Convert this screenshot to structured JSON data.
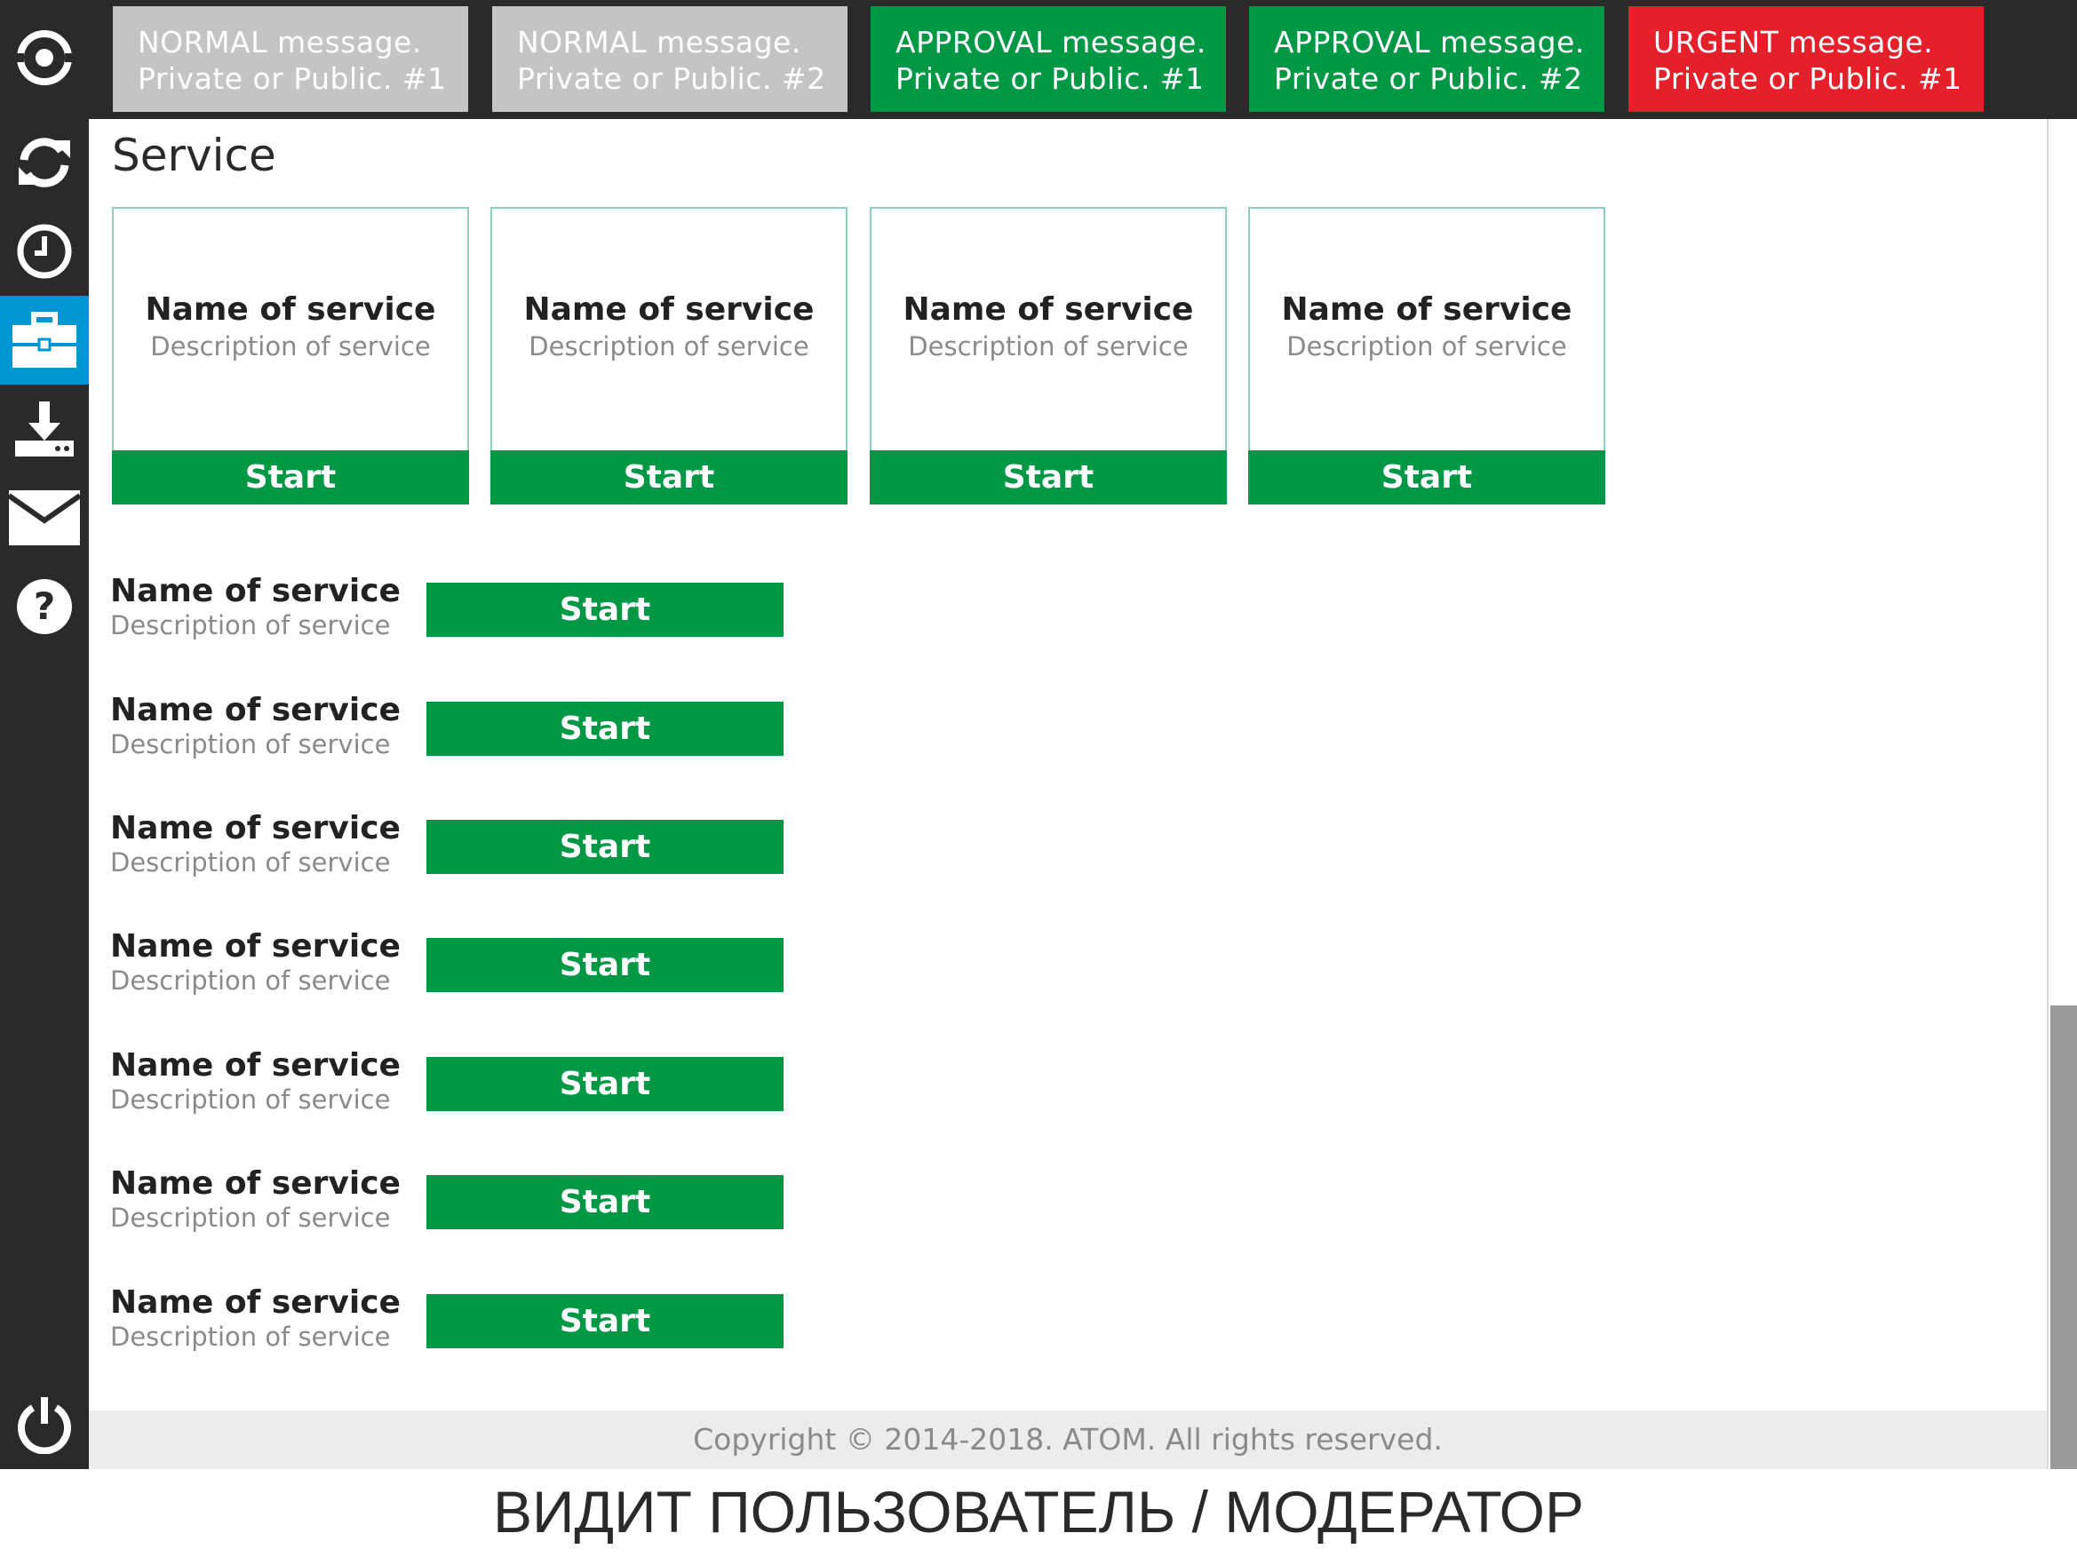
{
  "sidebar": {
    "items": [
      {
        "icon": "eye-icon"
      },
      {
        "icon": "sync-icon"
      },
      {
        "icon": "clock-icon"
      },
      {
        "icon": "briefcase-icon",
        "active": true
      },
      {
        "icon": "download-icon"
      },
      {
        "icon": "mail-icon"
      },
      {
        "icon": "help-icon"
      }
    ],
    "power_icon": "power-icon",
    "active_color": "#0096d6"
  },
  "messages": [
    {
      "type": "normal",
      "line1": "NORMAL message.",
      "line2": "Private or Public. #1",
      "color": "#c4c4c4"
    },
    {
      "type": "normal",
      "line1": "NORMAL message.",
      "line2": "Private or Public. #2",
      "color": "#c4c4c4"
    },
    {
      "type": "approval",
      "line1": "APPROVAL message.",
      "line2": "Private or Public. #1",
      "color": "#009844"
    },
    {
      "type": "approval",
      "line1": "APPROVAL message.",
      "line2": "Private or Public. #2",
      "color": "#009844"
    },
    {
      "type": "urgent",
      "line1": "URGENT message.",
      "line2": "Private or Public. #1",
      "color": "#e5202a"
    }
  ],
  "page_title": "Service",
  "cards": [
    {
      "name": "Name of service",
      "description": "Description of service",
      "button": "Start"
    },
    {
      "name": "Name of service",
      "description": "Description of service",
      "button": "Start"
    },
    {
      "name": "Name of service",
      "description": "Description of service",
      "button": "Start"
    },
    {
      "name": "Name of service",
      "description": "Description of service",
      "button": "Start"
    }
  ],
  "rows": [
    {
      "name": "Name of service",
      "description": "Description of service",
      "button": "Start"
    },
    {
      "name": "Name of service",
      "description": "Description of service",
      "button": "Start"
    },
    {
      "name": "Name of service",
      "description": "Description of service",
      "button": "Start"
    },
    {
      "name": "Name of service",
      "description": "Description of service",
      "button": "Start"
    },
    {
      "name": "Name of service",
      "description": "Description of service",
      "button": "Start"
    },
    {
      "name": "Name of service",
      "description": "Description of service",
      "button": "Start"
    },
    {
      "name": "Name of service",
      "description": "Description of service",
      "button": "Start"
    }
  ],
  "footer": "Copyright © 2014-2018. ATOM. All rights reserved.",
  "caption": "ВИДИТ ПОЛЬЗОВАТЕЛЬ / МОДЕРАТОР",
  "colors": {
    "start_button": "#009844",
    "sidebar_bg": "#2a2a2a",
    "card_border": "#8fcfbd"
  }
}
